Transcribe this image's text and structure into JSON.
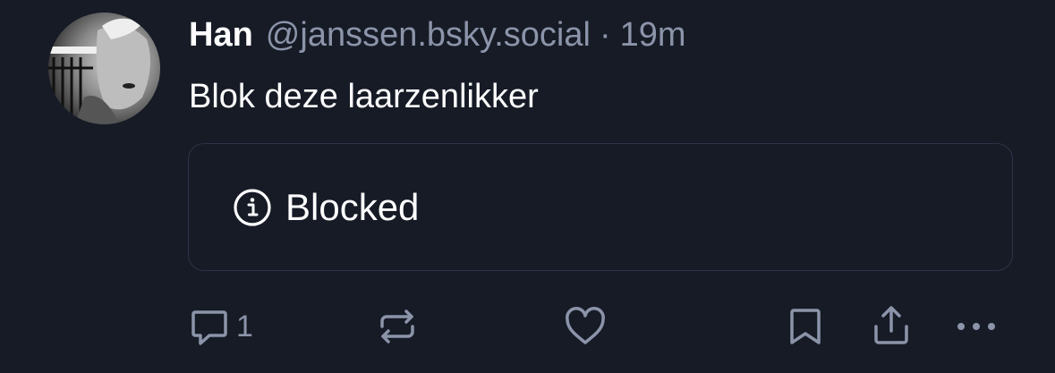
{
  "post": {
    "author_name": "Han",
    "author_handle": "@janssen.bsky.social",
    "separator": "·",
    "timestamp": "19m",
    "text": "Blok deze laarzenlikker"
  },
  "embed": {
    "icon": "info-icon",
    "label": "Blocked"
  },
  "actions": {
    "reply_count": "1",
    "icons": [
      "reply-icon",
      "repost-icon",
      "like-icon",
      "bookmark-icon",
      "share-icon",
      "more-icon"
    ]
  },
  "colors": {
    "background": "#161b26",
    "muted": "#8b94a9",
    "border": "#2c3446",
    "text": "#ffffff"
  }
}
